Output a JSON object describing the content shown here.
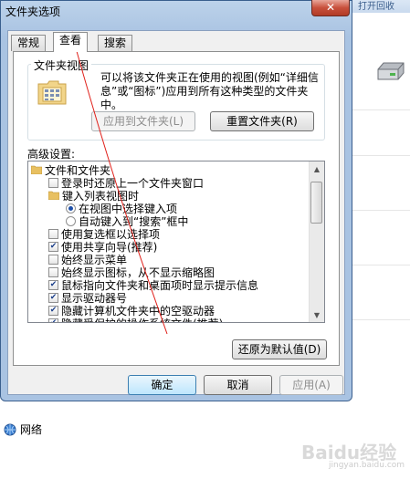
{
  "dialog": {
    "title": "文件夹选项",
    "close_glyph": "✕"
  },
  "tabs": [
    {
      "label": "常规"
    },
    {
      "label": "查看"
    },
    {
      "label": "搜索"
    }
  ],
  "folder_view": {
    "group_title": "文件夹视图",
    "description": "可以将该文件夹正在使用的视图(例如“详细信息”或“图标”)应用到所有这种类型的文件夹中。",
    "apply_button": "应用到文件夹(L)",
    "reset_button": "重置文件夹(R)"
  },
  "advanced": {
    "label": "高级设置:",
    "items": [
      {
        "text": "文件和文件夹",
        "kind": "folder"
      },
      {
        "text": "登录时还原上一个文件夹窗口",
        "kind": "checkbox",
        "checked": false
      },
      {
        "text": "键入列表视图时",
        "kind": "folder"
      },
      {
        "text": "在视图中选择键入项",
        "kind": "radio",
        "checked": true
      },
      {
        "text": "自动键入到“搜索”框中",
        "kind": "radio",
        "checked": false
      },
      {
        "text": "使用复选框以选择项",
        "kind": "checkbox",
        "checked": false
      },
      {
        "text": "使用共享向导(推荐)",
        "kind": "checkbox",
        "checked": true
      },
      {
        "text": "始终显示菜单",
        "kind": "checkbox",
        "checked": false
      },
      {
        "text": "始终显示图标，从不显示缩略图",
        "kind": "checkbox",
        "checked": false
      },
      {
        "text": "鼠标指向文件夹和桌面项时显示提示信息",
        "kind": "checkbox",
        "checked": true
      },
      {
        "text": "显示驱动器号",
        "kind": "checkbox",
        "checked": true
      },
      {
        "text": "隐藏计算机文件夹中的空驱动器",
        "kind": "checkbox",
        "checked": true
      },
      {
        "text": "隐藏受保护的操作系统文件(推荐)",
        "kind": "checkbox",
        "checked": true
      }
    ],
    "restore_button": "还原为默认值(D)"
  },
  "footer": {
    "ok": "确定",
    "cancel": "取消",
    "apply": "应用(A)"
  },
  "background": {
    "network_label": "网络",
    "top_label": "打开回收",
    "watermark": "Baidu经验",
    "watermark_sub": "jingyan.baidu.com"
  },
  "colors": {
    "annotation_arrow": "#e0201a",
    "title_bar": "#a9c3e2"
  }
}
